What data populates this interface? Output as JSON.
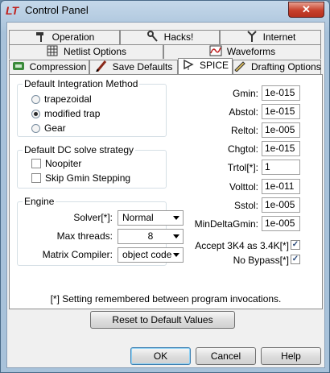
{
  "window": {
    "title": "Control Panel",
    "close_glyph": "✕",
    "app_icon_text": "LT"
  },
  "tabs": {
    "row1": [
      {
        "label": "Operation",
        "icon": "hammer-icon"
      },
      {
        "label": "Hacks!",
        "icon": "wrench-icon"
      },
      {
        "label": "Internet",
        "icon": "antenna-icon"
      }
    ],
    "row2": [
      {
        "label": "Netlist Options",
        "icon": "netlist-grid-icon"
      },
      {
        "label": "Waveforms",
        "icon": "waveform-icon"
      }
    ],
    "row3": [
      {
        "label": "Compression",
        "icon": "compression-icon"
      },
      {
        "label": "Save Defaults",
        "icon": "pencil-icon"
      },
      {
        "label": "SPICE",
        "icon": "opamp-icon"
      },
      {
        "label": "Drafting Options",
        "icon": "drafting-icon"
      }
    ],
    "active": "SPICE"
  },
  "integration": {
    "title": "Default Integration Method",
    "options": [
      "trapezoidal",
      "modified trap",
      "Gear"
    ],
    "selected": "modified trap"
  },
  "dc_solve": {
    "title": "Default DC solve strategy",
    "options": [
      {
        "label": "Noopiter",
        "checked": false
      },
      {
        "label": "Skip Gmin Stepping",
        "checked": false
      }
    ]
  },
  "engine": {
    "title": "Engine",
    "solver_label": "Solver[*]:",
    "solver_value": "Normal",
    "threads_label": "Max threads:",
    "threads_value": "8",
    "compiler_label": "Matrix Compiler:",
    "compiler_value": "object code"
  },
  "params": [
    {
      "label": "Gmin:",
      "value": "1e-015"
    },
    {
      "label": "Abstol:",
      "value": "1e-015"
    },
    {
      "label": "Reltol:",
      "value": "1e-005"
    },
    {
      "label": "Chgtol:",
      "value": "1e-015"
    },
    {
      "label": "Trtol[*]:",
      "value": "1"
    },
    {
      "label": "Volttol:",
      "value": "1e-011"
    },
    {
      "label": "Sstol:",
      "value": "1e-005"
    },
    {
      "label": "MinDeltaGmin:",
      "value": "1e-005"
    }
  ],
  "checks": [
    {
      "label": "Accept 3K4 as 3.4K[*]",
      "checked": true
    },
    {
      "label": "No Bypass[*]",
      "checked": true
    }
  ],
  "note": "[*] Setting remembered between program invocations.",
  "reset_label": "Reset to Default Values",
  "buttons": {
    "ok": "OK",
    "cancel": "Cancel",
    "help": "Help"
  },
  "check_glyph": "✓"
}
